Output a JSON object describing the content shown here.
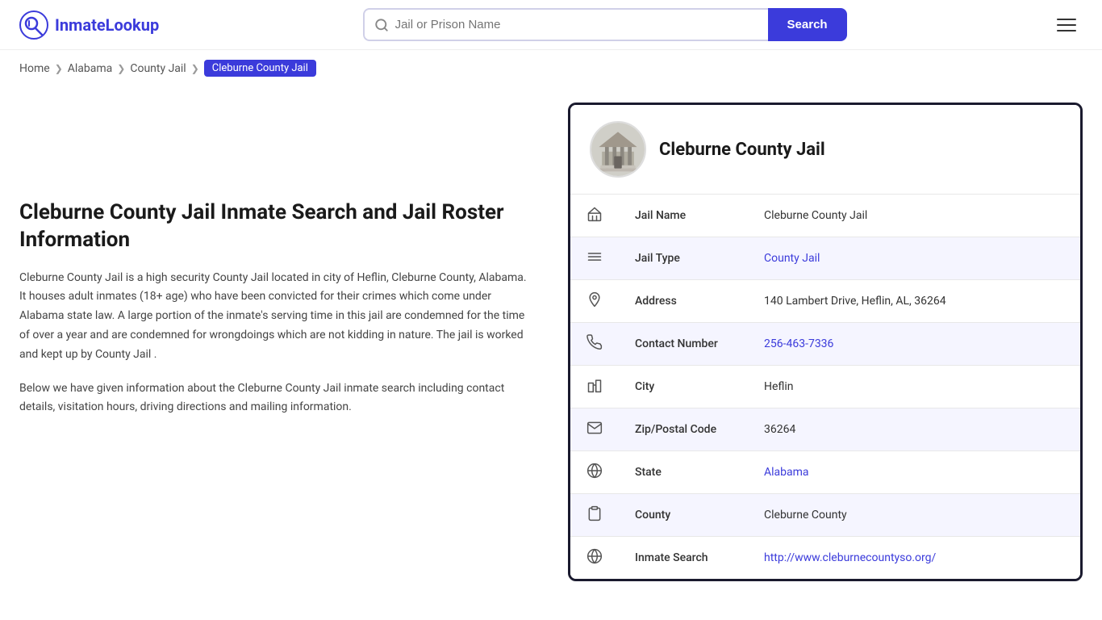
{
  "header": {
    "logo_text_part1": "Inmate",
    "logo_text_part2": "Lookup",
    "search_placeholder": "Jail or Prison Name",
    "search_button_label": "Search"
  },
  "breadcrumb": {
    "home": "Home",
    "state": "Alabama",
    "type": "County Jail",
    "current": "Cleburne County Jail"
  },
  "left": {
    "title": "Cleburne County Jail Inmate Search and Jail Roster Information",
    "description1": "Cleburne County Jail is a high security County Jail located in city of Heflin, Cleburne County, Alabama. It houses adult inmates (18+ age) who have been convicted for their crimes which come under Alabama state law. A large portion of the inmate's serving time in this jail are condemned for the time of over a year and are condemned for wrongdoings which are not kidding in nature. The jail is worked and kept up by County Jail .",
    "description2": "Below we have given information about the Cleburne County Jail inmate search including contact details, visitation hours, driving directions and mailing information."
  },
  "card": {
    "title": "Cleburne County Jail",
    "rows": [
      {
        "icon": "🏛",
        "label": "Jail Name",
        "value": "Cleburne County Jail",
        "link": null
      },
      {
        "icon": "≡",
        "label": "Jail Type",
        "value": "County Jail",
        "link": "#"
      },
      {
        "icon": "📍",
        "label": "Address",
        "value": "140 Lambert Drive, Heflin, AL, 36264",
        "link": null
      },
      {
        "icon": "📞",
        "label": "Contact Number",
        "value": "256-463-7336",
        "link": "tel:256-463-7336"
      },
      {
        "icon": "🏙",
        "label": "City",
        "value": "Heflin",
        "link": null
      },
      {
        "icon": "✉",
        "label": "Zip/Postal Code",
        "value": "36264",
        "link": null
      },
      {
        "icon": "🌐",
        "label": "State",
        "value": "Alabama",
        "link": "#"
      },
      {
        "icon": "📋",
        "label": "County",
        "value": "Cleburne County",
        "link": null
      },
      {
        "icon": "🌐",
        "label": "Inmate Search",
        "value": "http://www.cleburnecountyso.org/",
        "link": "http://www.cleburnecountyso.org/"
      }
    ]
  }
}
